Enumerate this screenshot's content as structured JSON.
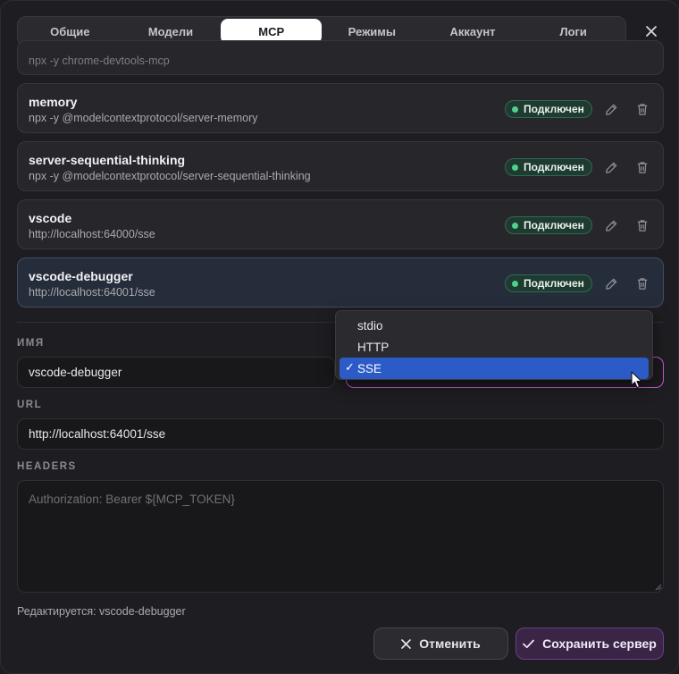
{
  "tabs": [
    {
      "label": "Общие",
      "active": false
    },
    {
      "label": "Модели",
      "active": false
    },
    {
      "label": "MCP",
      "active": true
    },
    {
      "label": "Режимы",
      "active": false
    },
    {
      "label": "Аккаунт",
      "active": false
    },
    {
      "label": "Логи",
      "active": false
    }
  ],
  "servers": {
    "partial_cmd": "npx -y chrome-devtools-mcp",
    "items": [
      {
        "name": "memory",
        "cmd": "npx -y @modelcontextprotocol/server-memory",
        "status": "Подключен"
      },
      {
        "name": "server-sequential-thinking",
        "cmd": "npx -y @modelcontextprotocol/server-sequential-thinking",
        "status": "Подключен"
      },
      {
        "name": "vscode",
        "cmd": "http://localhost:64000/sse",
        "status": "Подключен"
      },
      {
        "name": "vscode-debugger",
        "cmd": "http://localhost:64001/sse",
        "status": "Подключен"
      }
    ]
  },
  "form": {
    "name_label": "ИМЯ",
    "name_value": "vscode-debugger",
    "url_label": "URL",
    "url_value": "http://localhost:64001/sse",
    "headers_label": "HEADERS",
    "headers_placeholder": "Authorization: Bearer ${MCP_TOKEN}",
    "transport_options": [
      "stdio",
      "HTTP",
      "SSE"
    ],
    "transport_selected": "SSE",
    "check_mark": "✓"
  },
  "footer": {
    "editing_text": "Редактируется: vscode-debugger",
    "cancel_label": "Отменить",
    "save_label": "Сохранить сервер"
  },
  "colors": {
    "accent_purple": "#c55bd0",
    "status_green": "#4fd18b",
    "selection_blue": "#2c5bc8"
  },
  "icons": [
    "close-icon",
    "edit-icon",
    "delete-icon",
    "cancel-x-icon",
    "check-icon",
    "status-dot",
    "mouse-pointer-icon"
  ]
}
